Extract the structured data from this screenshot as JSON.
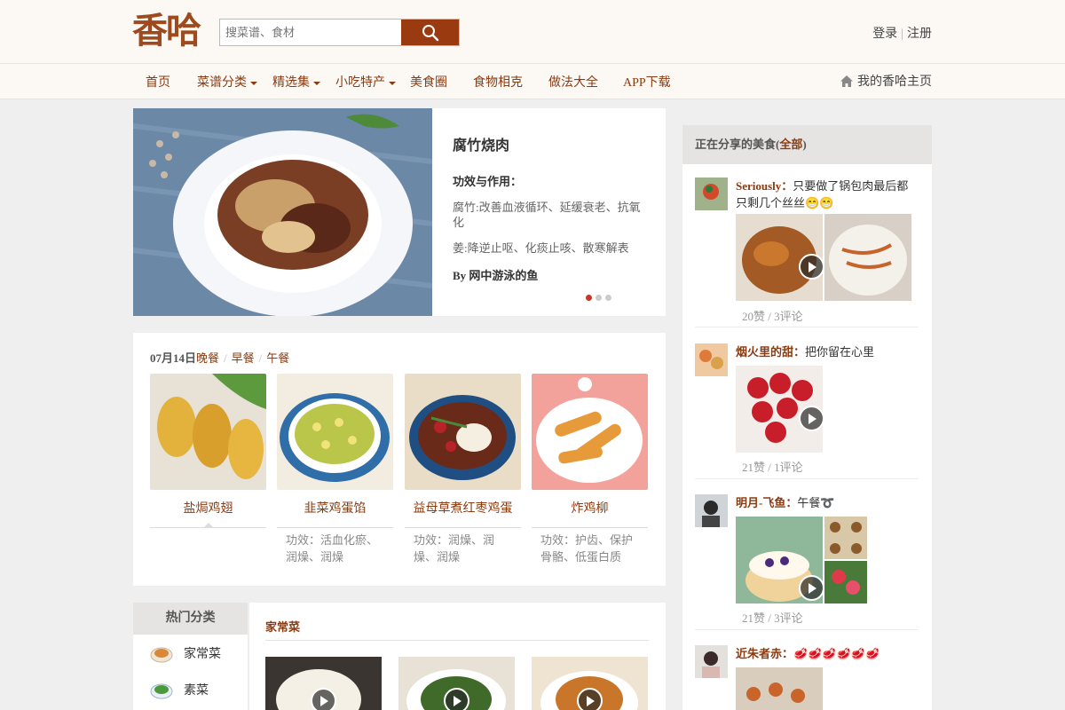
{
  "header": {
    "logo": "香哈",
    "search_placeholder": "搜菜谱、食材",
    "login": "登录",
    "register": "注册"
  },
  "nav": {
    "items": [
      "首页",
      "菜谱分类",
      "精选集",
      "小吃特产",
      "美食圈",
      "食物相克",
      "做法大全",
      "APP下载"
    ],
    "my_home": "我的香哈主页"
  },
  "feature": {
    "title": "腐竹烧肉",
    "effect_label": "功效与作用：",
    "effects": [
      "腐竹:改善血液循环、延缓衰老、抗氧化",
      "姜:降逆止呕、化痰止咳、散寒解表"
    ],
    "author": "By 网中游泳的鱼",
    "slide_count": 3,
    "active_slide": 0
  },
  "meals": {
    "date": "07月14日",
    "tabs": [
      "晚餐",
      "早餐",
      "午餐"
    ],
    "items": [
      {
        "name": "盐焗鸡翅",
        "effect": ""
      },
      {
        "name": "韭菜鸡蛋馅",
        "effect": "功效：活血化瘀、润燥、润燥"
      },
      {
        "name": "益母草煮红枣鸡蛋",
        "effect": "功效：润燥、润燥、润燥"
      },
      {
        "name": "炸鸡柳",
        "effect": "功效：护齿、保护骨骼、低蛋白质"
      }
    ]
  },
  "categories": {
    "heading": "热门分类",
    "items": [
      "家常菜",
      "素菜"
    ],
    "current": "家常菜"
  },
  "feed": {
    "heading": "正在分享的美食(",
    "all_link": "全部",
    "heading_end": ")",
    "posts": [
      {
        "user": "Seriously：",
        "text": "只要做了锅包肉最后都只剩几个丝丝😁😁",
        "stats": "20赞 / 3评论"
      },
      {
        "user": "烟火里的甜：",
        "text": "把你留在心里",
        "stats": "21赞 / 1评论"
      },
      {
        "user": "明月-飞鱼：",
        "text": "午餐➰",
        "stats": "21赞 / 3评论"
      },
      {
        "user": "近朱者赤：",
        "text": "🥩🥩🥩🥩🥩🥩",
        "stats": ""
      }
    ]
  },
  "colors": {
    "brand": "#9c4a1e",
    "link": "#8a3b12",
    "accent_dot": "#c0392b"
  }
}
